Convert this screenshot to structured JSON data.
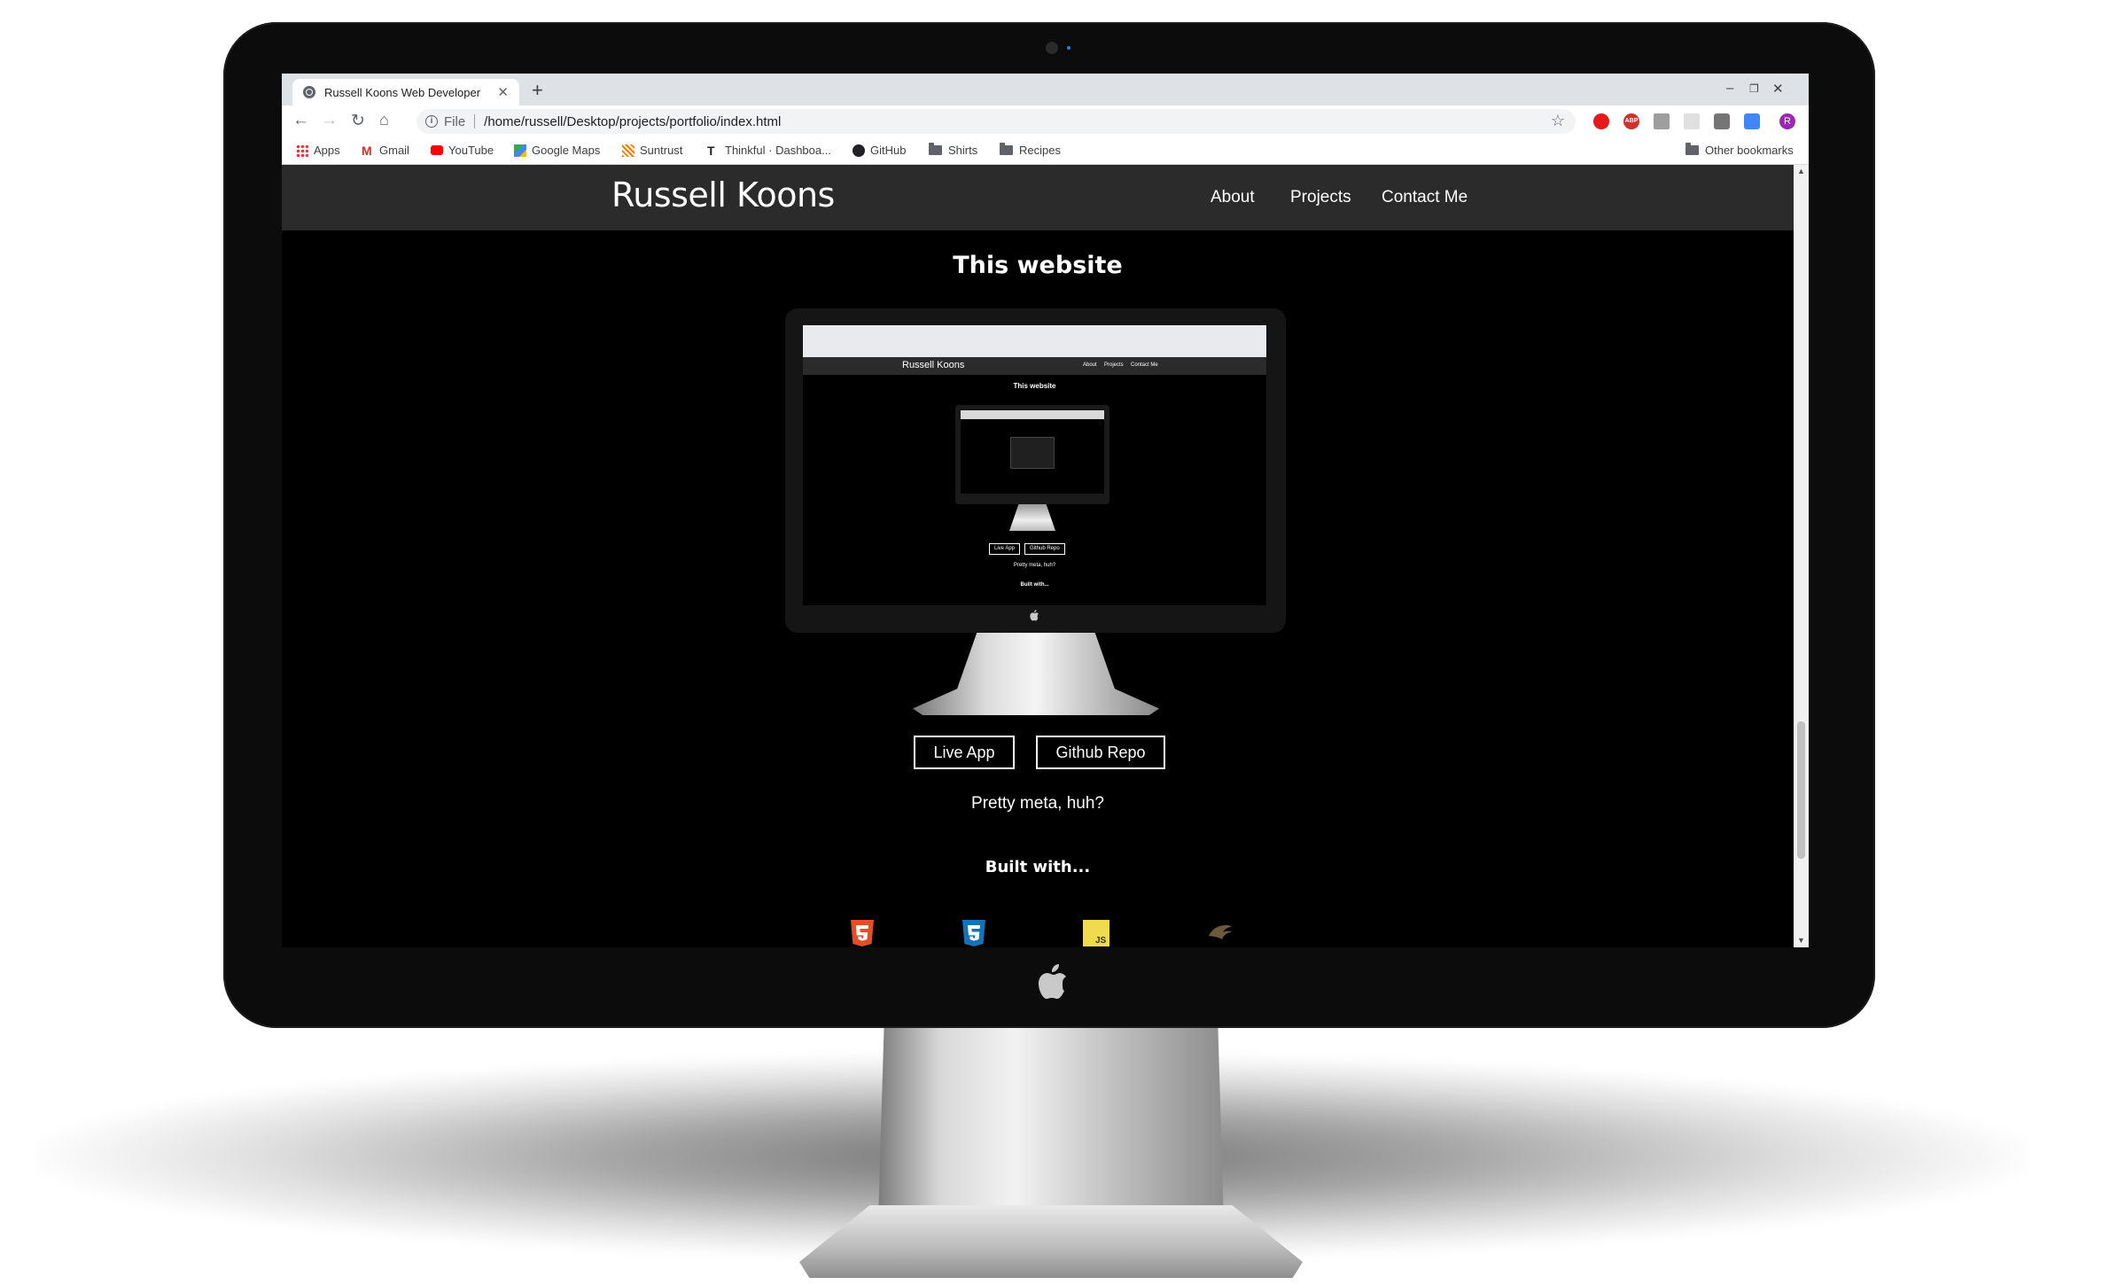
{
  "browser": {
    "tab_title": "Russell Koons Web Developer",
    "new_tab_symbol": "+",
    "tab_close_symbol": "✕",
    "url_scheme": "File",
    "url": "/home/russell/Desktop/projects/portfolio/index.html",
    "window_controls": [
      "–",
      "❐",
      "✕"
    ],
    "profile_initial": "R",
    "bookmarks": [
      "Apps",
      "Gmail",
      "YouTube",
      "Google Maps",
      "Suntrust",
      "Thinkful · Dashboa...",
      "GitHub",
      "Shirts",
      "Recipes"
    ],
    "other_bookmarks": "Other bookmarks"
  },
  "site": {
    "brand": "Russell Koons",
    "nav": [
      "About",
      "Projects",
      "Contact Me"
    ],
    "section_title": "This website",
    "buttons": [
      "Live App",
      "Github Repo"
    ],
    "tagline": "Pretty meta, huh?",
    "built_with": "Built with...",
    "tech_icons": [
      "html5-icon",
      "css3-icon",
      "javascript-icon",
      "jquery-icon"
    ]
  },
  "colors": {
    "page_bg": "#000000",
    "nav_bg": "#2b2b2b",
    "html5": "#e34f26",
    "css3": "#1572b6",
    "js": "#f0db4f"
  }
}
